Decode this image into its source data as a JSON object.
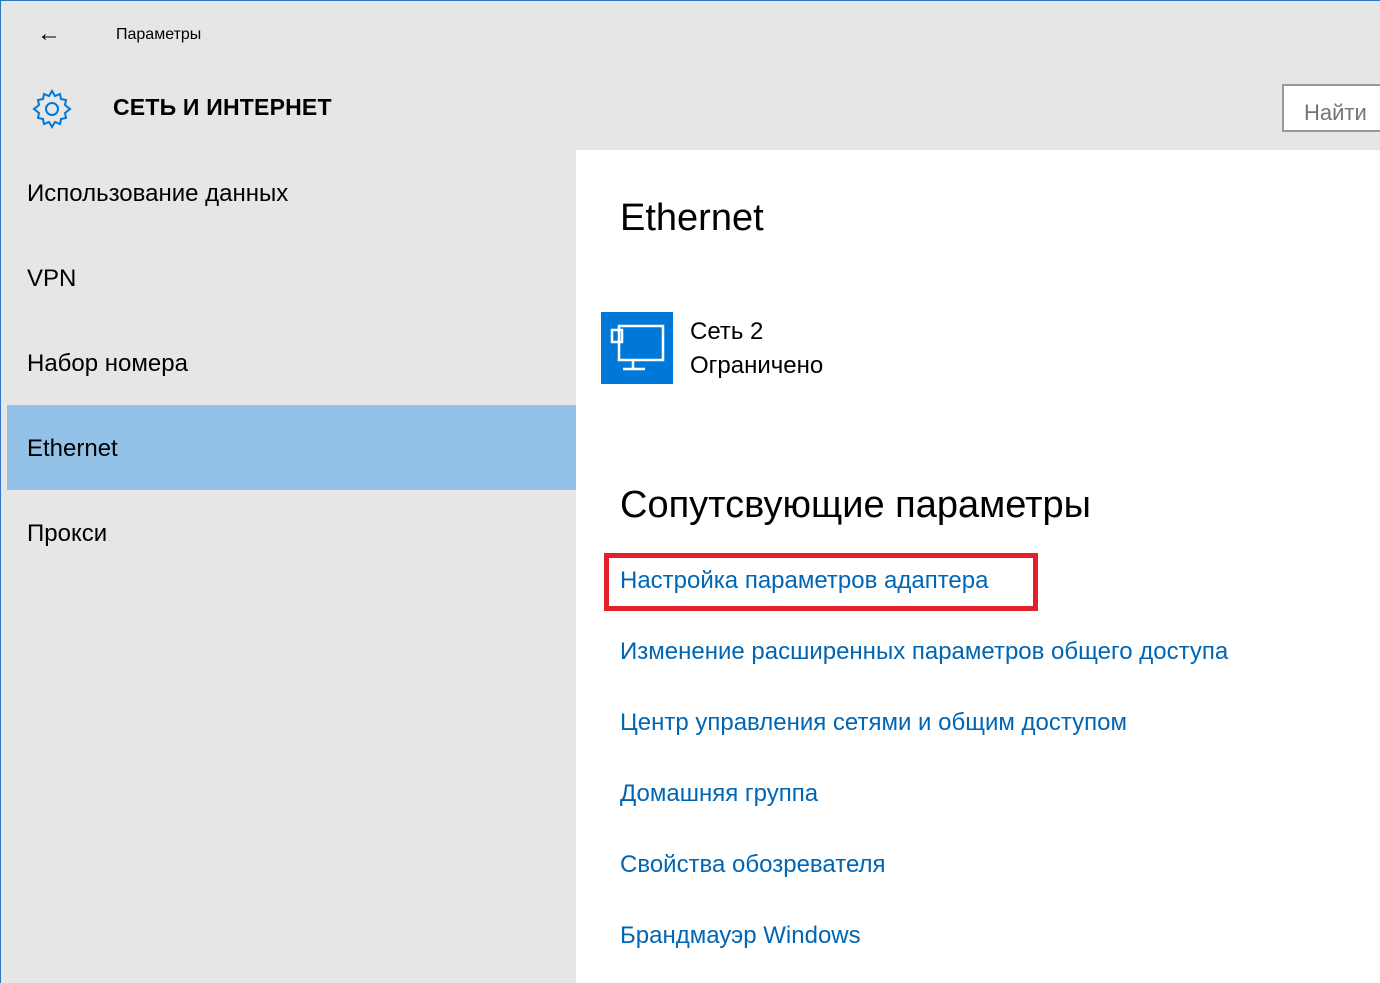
{
  "window": {
    "title": "Параметры"
  },
  "header": {
    "section_title": "СЕТЬ И ИНТЕРНЕТ",
    "search_placeholder": "Найти"
  },
  "sidebar": {
    "items": [
      {
        "label": "Использование данных",
        "selected": false
      },
      {
        "label": "VPN",
        "selected": false
      },
      {
        "label": "Набор номера",
        "selected": false
      },
      {
        "label": "Ethernet",
        "selected": true
      },
      {
        "label": "Прокси",
        "selected": false
      }
    ]
  },
  "main": {
    "title": "Ethernet",
    "network": {
      "name": "Сеть  2",
      "status": "Ограничено",
      "icon": "network-monitor-icon"
    },
    "related_title": "Сопутсвующие параметры",
    "links": [
      "Настройка параметров адаптера",
      "Изменение расширенных параметров общего доступа",
      "Центр управления сетями и общим доступом",
      "Домашняя группа",
      "Свойства обозревателя",
      "Брандмауэр Windows"
    ]
  },
  "colors": {
    "chrome_bg": "#e6e6e6",
    "selected_bg": "#93c1e8",
    "accent": "#0078d7",
    "link": "#0066b4",
    "highlight_border": "#e3202c"
  }
}
